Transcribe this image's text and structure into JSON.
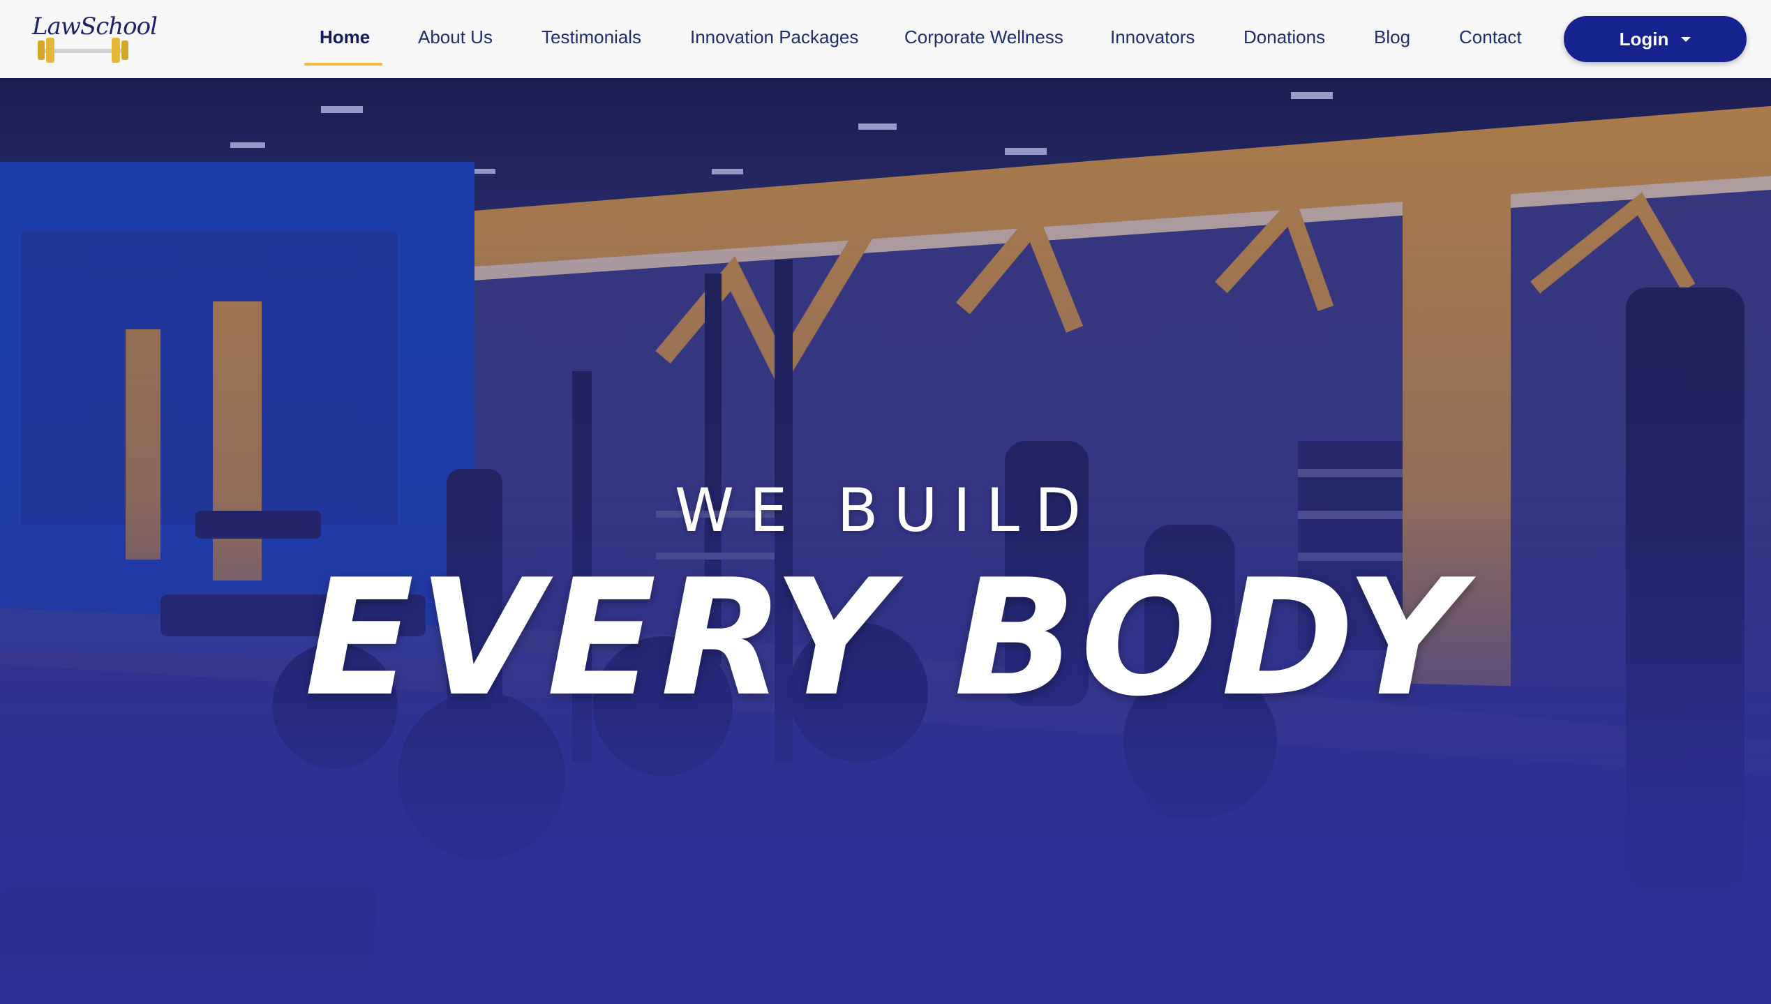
{
  "logo": {
    "text": "LawSchool"
  },
  "nav": {
    "items": [
      {
        "label": "Home",
        "active": true
      },
      {
        "label": "About Us"
      },
      {
        "label": "Testimonials"
      },
      {
        "label": "Innovation Packages"
      },
      {
        "label": "Corporate Wellness"
      },
      {
        "label": "Innovators"
      },
      {
        "label": "Donations"
      },
      {
        "label": "Blog"
      },
      {
        "label": "Contact"
      }
    ],
    "login_label": "Login"
  },
  "hero": {
    "subtitle": "WE BUILD",
    "title": "EVERY BODY"
  },
  "colors": {
    "navbar_bg": "#f7f7f8",
    "nav_text": "#1f2c6e",
    "active_underline": "#f4b93a",
    "login_bg": "#16238f",
    "hero_overlay": "#2a3096",
    "accent_yellow": "#f0a726",
    "wall_blue": "#1446b8"
  },
  "icons": {
    "login_caret": "caret-down-icon",
    "logo_image": "barbell-icon"
  }
}
